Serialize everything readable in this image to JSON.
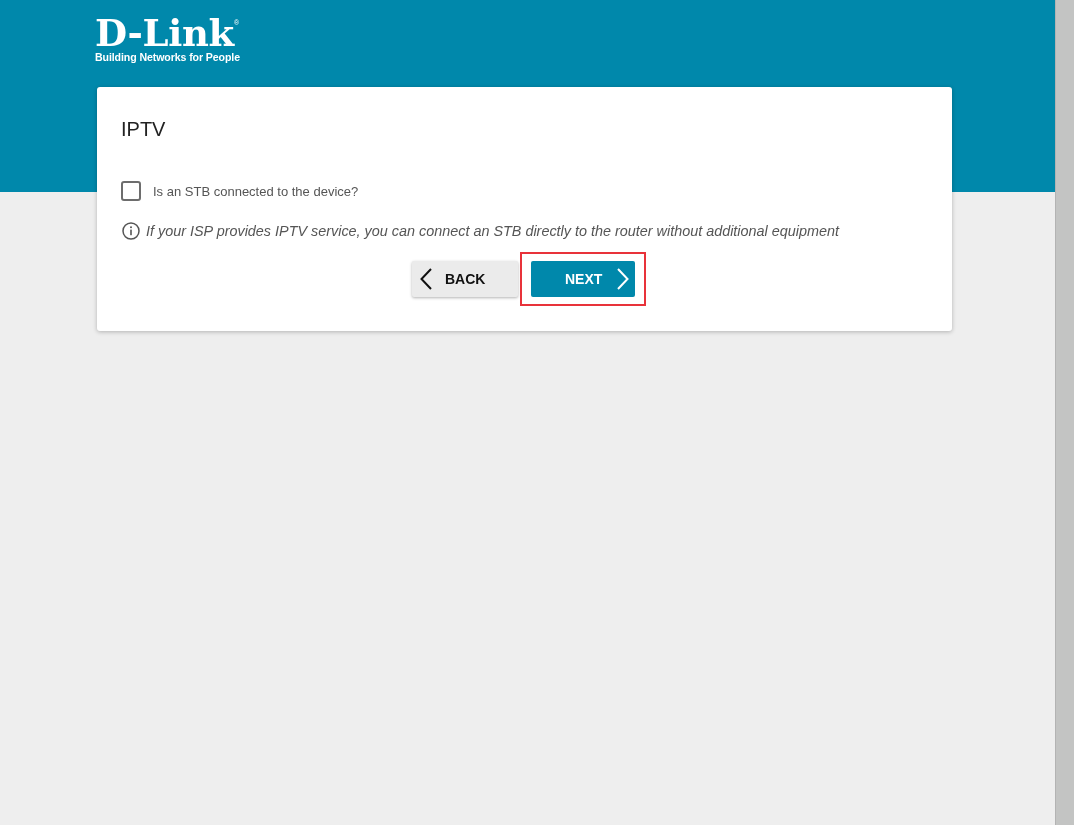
{
  "logo": {
    "brand": "D-Link",
    "registered_mark": "®",
    "tagline": "Building Networks for People"
  },
  "card": {
    "title": "IPTV",
    "checkbox": {
      "label": "Is an STB connected to the device?",
      "checked": false
    },
    "info": "If your ISP provides IPTV service, you can connect an STB directly to the router without additional equipment",
    "buttons": [
      {
        "kind": "back",
        "label": "BACK",
        "highlighted": false
      },
      {
        "kind": "next",
        "label": "NEXT",
        "highlighted": true
      }
    ]
  }
}
